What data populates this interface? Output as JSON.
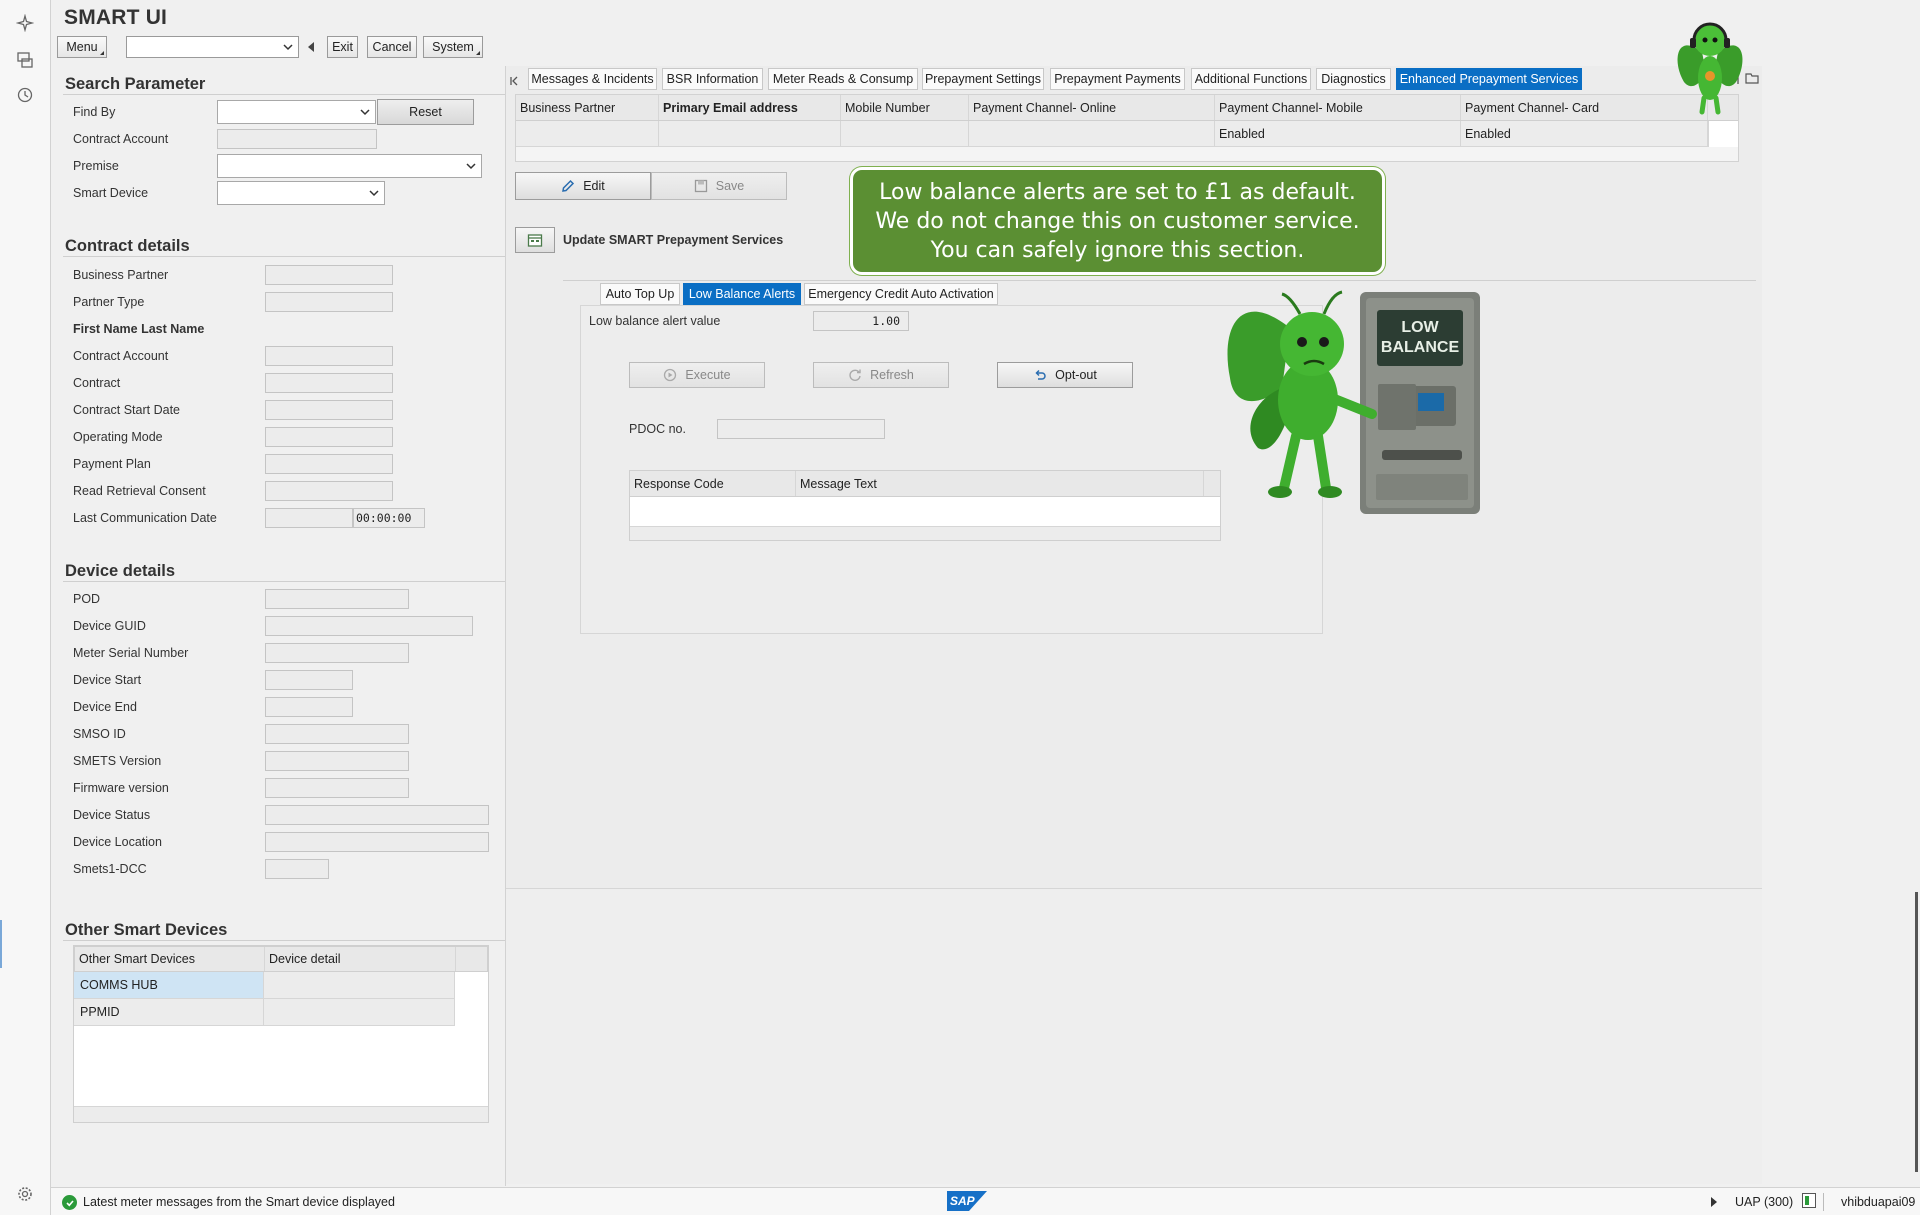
{
  "app": {
    "title": "SMART UI"
  },
  "toolbar": {
    "menu": "Menu",
    "exit": "Exit",
    "cancel": "Cancel",
    "system": "System"
  },
  "search": {
    "title": "Search Parameter",
    "find_by": "Find By",
    "reset": "Reset",
    "contract_account": "Contract Account",
    "premise": "Premise",
    "smart_device": "Smart Device"
  },
  "contract": {
    "title": "Contract details",
    "labels": [
      "Business Partner",
      "Partner Type",
      "First Name Last Name",
      "Contract Account",
      "Contract",
      "Contract Start Date",
      "Operating Mode",
      "Payment Plan",
      "Read Retrieval Consent",
      "Last Communication Date"
    ],
    "last_comm_time": "00:00:00"
  },
  "device": {
    "title": "Device details",
    "labels": [
      "POD",
      "Device GUID",
      "Meter Serial Number",
      "Device Start",
      "Device End",
      "SMSO ID",
      "SMETS Version",
      "Firmware version",
      "Device Status",
      "Device Location",
      "Smets1-DCC"
    ]
  },
  "other": {
    "title": "Other Smart Devices",
    "col1": "Other Smart Devices",
    "col2": "Device detail",
    "rows": [
      "COMMS HUB",
      "PPMID"
    ]
  },
  "tabs": [
    "Messages & Incidents",
    "BSR Information",
    "Meter Reads & Consump",
    "Prepayment Settings",
    "Prepayment Payments",
    "Additional Functions",
    "Diagnostics",
    "Enhanced Prepayment Services"
  ],
  "ep": {
    "headers": [
      "Business Partner",
      "Primary Email address",
      "Mobile Number",
      "Payment Channel- Online",
      "Payment Channel- Mobile",
      "Payment Channel- Card"
    ],
    "mobile_value": "Enabled",
    "card_value": "Enabled",
    "edit": "Edit",
    "save": "Save",
    "update_title": "Update SMART Prepayment Services"
  },
  "subtabs": [
    "Auto Top Up",
    "Low Balance Alerts",
    "Emergency Credit Auto Activation"
  ],
  "lba": {
    "value_label": "Low balance alert value",
    "value": "1.00",
    "execute": "Execute",
    "refresh": "Refresh",
    "optout": "Opt-out",
    "pdoc": "PDOC no.",
    "col_code": "Response Code",
    "col_msg": "Message Text"
  },
  "callout": {
    "line1": "Low balance alerts are set to £1 as default.",
    "line2": "We do not change this on customer service.",
    "line3": "You can safely ignore this section."
  },
  "atm": {
    "line1": "LOW",
    "line2": "BALANCE"
  },
  "status": {
    "message": "Latest meter messages from the Smart device displayed",
    "logo": "SAP",
    "system": "UAP (300)",
    "user": "vhibduapai09"
  }
}
